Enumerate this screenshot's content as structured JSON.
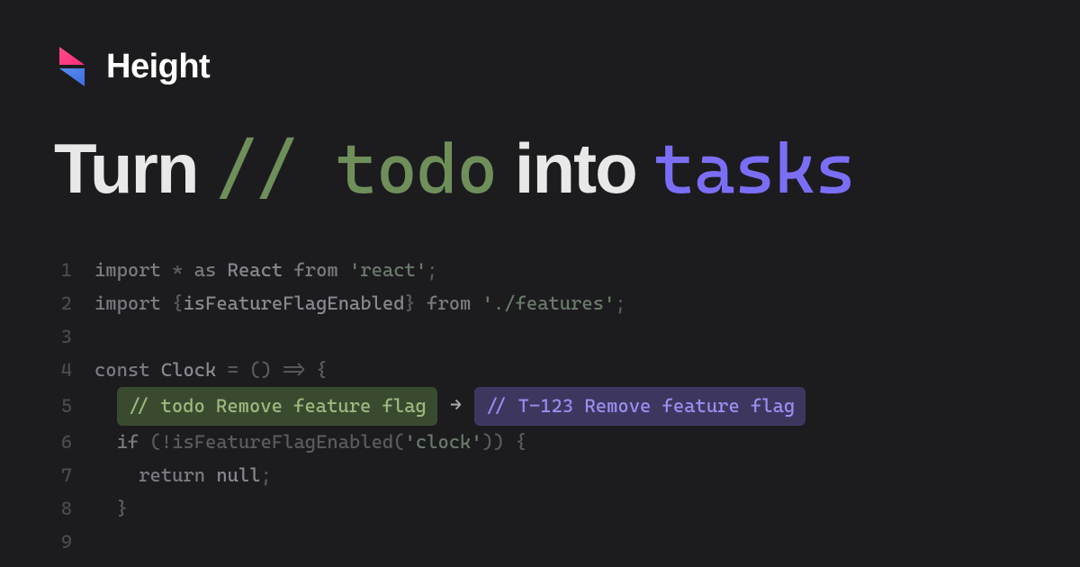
{
  "brand": {
    "name": "Height"
  },
  "headline": {
    "turn": "Turn",
    "todo": "// todo",
    "into": "into",
    "tasks": "tasks"
  },
  "code": {
    "lines": [
      "1",
      "2",
      "3",
      "4",
      "5",
      "6",
      "7",
      "8",
      "9"
    ],
    "l1": {
      "kw1": "import",
      "star": " * ",
      "kw2": "as",
      "ident": " React ",
      "kw3": "from",
      "str": " 'react'",
      "semi": ";"
    },
    "l2": {
      "kw1": "import",
      "brace1": " {",
      "ident": "isFeatureFlagEnabled",
      "brace2": "} ",
      "kw2": "from",
      "str": " './features'",
      "semi": ";"
    },
    "l4": {
      "kw1": "const",
      "ident": " Clock ",
      "eq": "= () => {"
    },
    "l5": {
      "todo": "// todo Remove feature flag",
      "arrow": "→",
      "task": "// T-123 Remove feature flag"
    },
    "l6": {
      "kw1": "if",
      "cond": " (!isFeatureFlagEnabled(",
      "str": "'clock'",
      "close": ")) {"
    },
    "l7": {
      "kw1": "return",
      "val": " null",
      "semi": ";"
    },
    "l8": {
      "brace": "}"
    }
  }
}
